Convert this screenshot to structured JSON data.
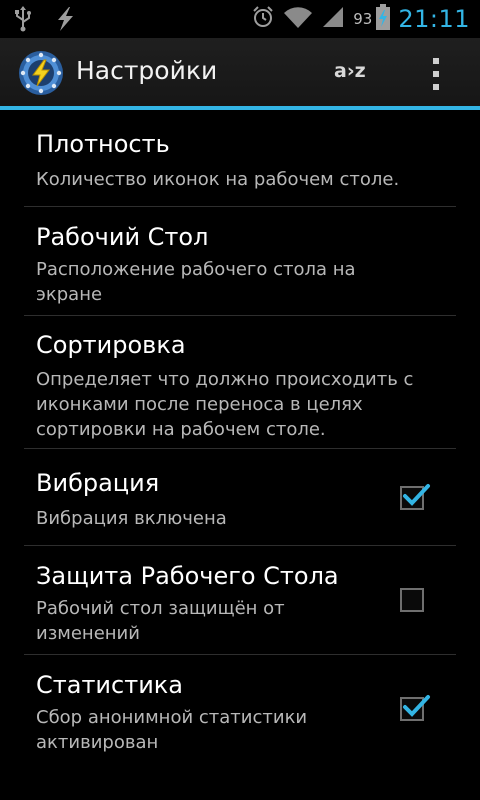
{
  "status_bar": {
    "icons": [
      "usb-icon",
      "lightning-icon",
      "alarm-icon",
      "wifi-icon",
      "signal-icon",
      "battery-charging-icon"
    ],
    "battery_percent": "93",
    "time": "21:11",
    "accent": "#33b5e5"
  },
  "action_bar": {
    "title": "Настройки",
    "sort_label": "a›z",
    "app_icon": "lightning-bolt-app-icon",
    "overflow_icon": "overflow-menu-icon"
  },
  "settings": [
    {
      "title": "Плотность",
      "summary": "Количество иконок на рабочем столе."
    },
    {
      "title": "Рабочий Стол",
      "summary": "Расположение рабочего стола на экране"
    },
    {
      "title": "Сортировка",
      "summary": "Определяет что должно происходить с иконками после переноса в целях сортировки на рабочем столе."
    },
    {
      "title": "Вибрация",
      "summary": "Вибрация включена",
      "checked": true
    },
    {
      "title": "Защита Рабочего Стола",
      "summary": "Рабочий стол защищён от изменений",
      "checked": false
    },
    {
      "title": "Статистика",
      "summary": "Сбор анонимной статистики активирован",
      "checked": true
    }
  ]
}
